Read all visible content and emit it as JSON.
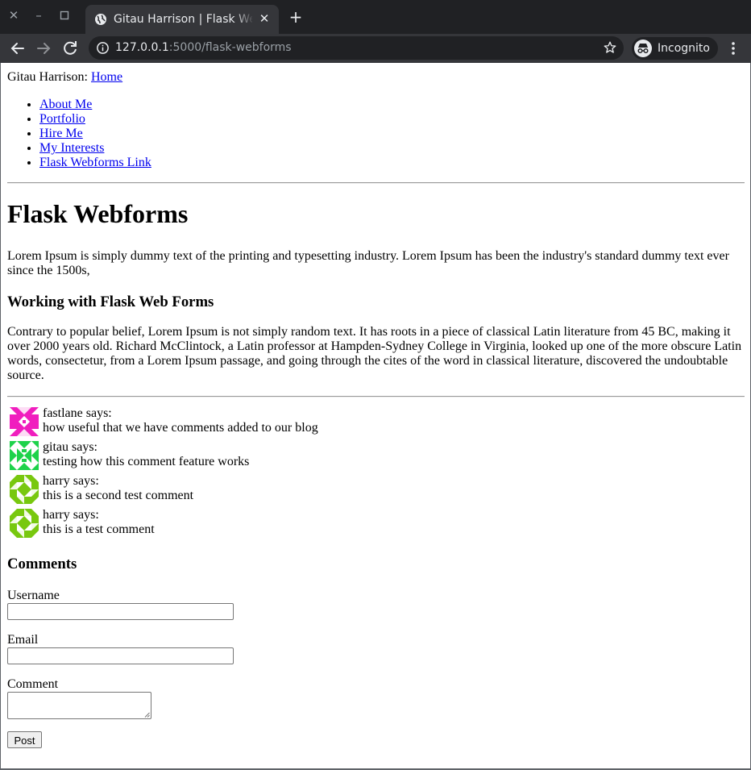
{
  "browser": {
    "tab_title": "Gitau Harrison | Flask Webforms",
    "url_host": "127.0.0.1",
    "url_path": ":5000/flask-webforms",
    "profile_label": "Incognito",
    "icons": [
      "close-window-icon",
      "minimize-icon",
      "maximize-icon",
      "globe-icon",
      "close-tab-icon",
      "new-tab-icon",
      "back-arrow-icon",
      "forward-arrow-icon",
      "reload-icon",
      "info-icon",
      "star-icon",
      "incognito-icon",
      "menu-dots-icon"
    ]
  },
  "page": {
    "site_name": "Gitau Harrison:",
    "home_link": "Home",
    "nav": [
      "About Me",
      "Portfolio",
      "Hire Me",
      "My Interests",
      "Flask Webforms Link"
    ],
    "title": "Flask Webforms",
    "intro": "Lorem Ipsum is simply dummy text of the printing and typesetting industry. Lorem Ipsum has been the industry's standard dummy text ever since the 1500s,",
    "section_heading": "Working with Flask Web Forms",
    "section_body": "Contrary to popular belief, Lorem Ipsum is not simply random text. It has roots in a piece of classical Latin literature from 45 BC, making it over 2000 years old. Richard McClintock, a Latin professor at Hampden-Sydney College in Virginia, looked up one of the more obscure Latin words, consectetur, from a Lorem Ipsum passage, and going through the cites of the word in classical literature, discovered the undoubtable source.",
    "comments": [
      {
        "author_line": "fastlane says:",
        "body": "how useful that we have comments added to our blog",
        "avatar_color": "#f01ebe"
      },
      {
        "author_line": "gitau says:",
        "body": "testing how this comment feature works",
        "avatar_color": "#1ed24b"
      },
      {
        "author_line": "harry says:",
        "body": "this is a second test comment",
        "avatar_color": "#78c80f"
      },
      {
        "author_line": "harry says:",
        "body": "this is a test comment",
        "avatar_color": "#78c80f"
      }
    ],
    "form": {
      "heading": "Comments",
      "username_label": "Username",
      "username_value": "",
      "email_label": "Email",
      "email_value": "",
      "comment_label": "Comment",
      "comment_value": "",
      "submit_label": "Post"
    }
  },
  "colors": {
    "chrome_dark": "#202124",
    "toolbar": "#35363a",
    "link": "#0000ee"
  }
}
